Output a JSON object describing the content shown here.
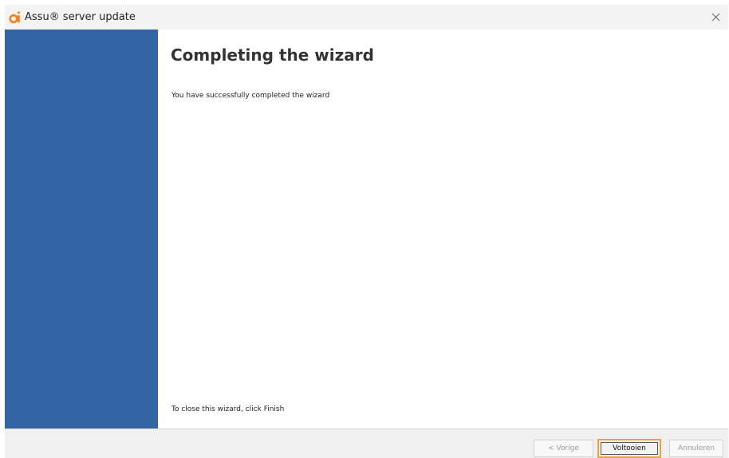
{
  "window": {
    "title": "Assu® server update",
    "app_icon": "assu-logo-icon",
    "close_icon": "close-icon"
  },
  "colors": {
    "side_panel": "#3365a5",
    "accent_orange": "#f0a33b",
    "title_bar": "#f3f3f3",
    "button_bar": "#f0f0f0"
  },
  "main": {
    "heading": "Completing the wizard",
    "message": "You have successfully completed the wizard",
    "close_hint": "To close this wizard, click Finish"
  },
  "buttons": {
    "back_label": "< Vorige",
    "finish_label": "Voltooien",
    "cancel_label": "Annuleren"
  }
}
